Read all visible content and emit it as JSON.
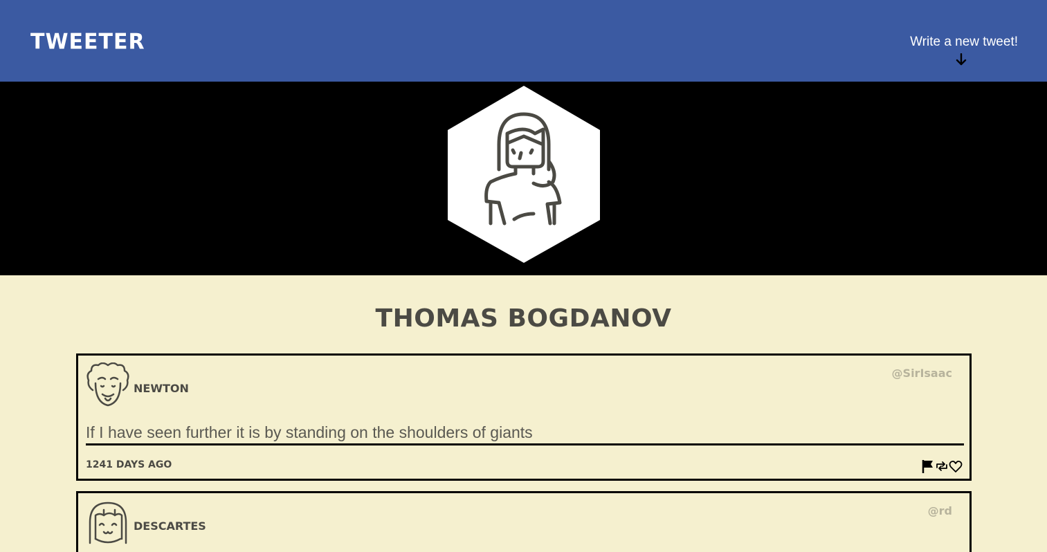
{
  "header": {
    "brand": "TWEETER",
    "compose_label": "Write a new tweet!",
    "background_color": "#3b5aa2"
  },
  "profile": {
    "name": "THOMAS BOGDANOV",
    "avatar_icon": "woman-avatar-icon"
  },
  "tweets": [
    {
      "author": "NEWTON",
      "handle": "@SirIsaac",
      "text": "If I have seen further it is by standing on the shoulders of giants",
      "time": "1241 DAYS AGO",
      "avatar_icon": "curly-hair-avatar-icon"
    },
    {
      "author": "DESCARTES",
      "handle": "@rd",
      "avatar_icon": "bob-hair-avatar-icon"
    }
  ],
  "colors": {
    "page_bg": "#f5f0cf",
    "hero_bg": "#000000",
    "text": "#4b4a44",
    "handle": "#b7b39c"
  }
}
